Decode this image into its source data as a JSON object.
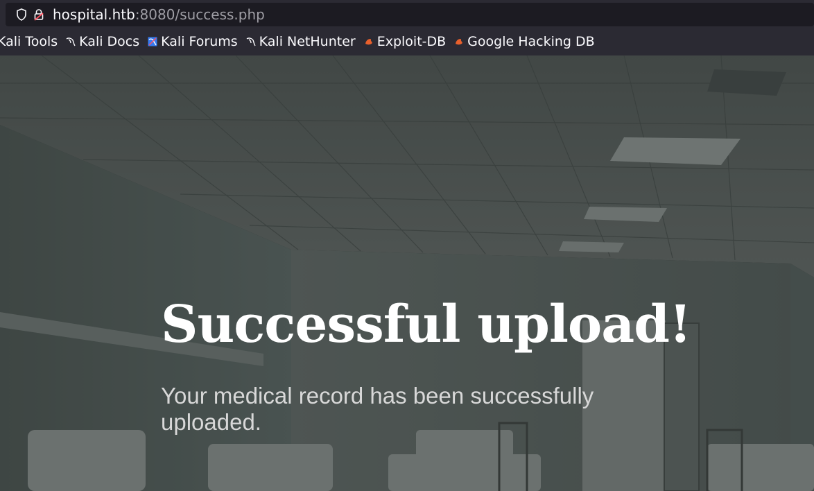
{
  "browser": {
    "url_host": "hospital.htb",
    "url_rest": ":8080/success.php",
    "bookmarks": [
      {
        "label": "Kali Tools",
        "icon": "kali-dragon-icon"
      },
      {
        "label": "Kali Docs",
        "icon": "kali-dragon-icon"
      },
      {
        "label": "Kali Forums",
        "icon": "kali-forums-icon"
      },
      {
        "label": "Kali NetHunter",
        "icon": "kali-dragon-icon"
      },
      {
        "label": "Exploit-DB",
        "icon": "exploit-db-icon"
      },
      {
        "label": "Google Hacking DB",
        "icon": "exploit-db-icon"
      }
    ]
  },
  "page": {
    "title": "Successful upload!",
    "subtitle": "Your medical record has been successfully uploaded."
  },
  "colors": {
    "chrome_bg": "#2b2a33",
    "urlbar_bg": "#1c1b22",
    "title_color": "#ffffff",
    "subtitle_color": "#d8d8d8",
    "accent_orange": "#e8602c"
  }
}
